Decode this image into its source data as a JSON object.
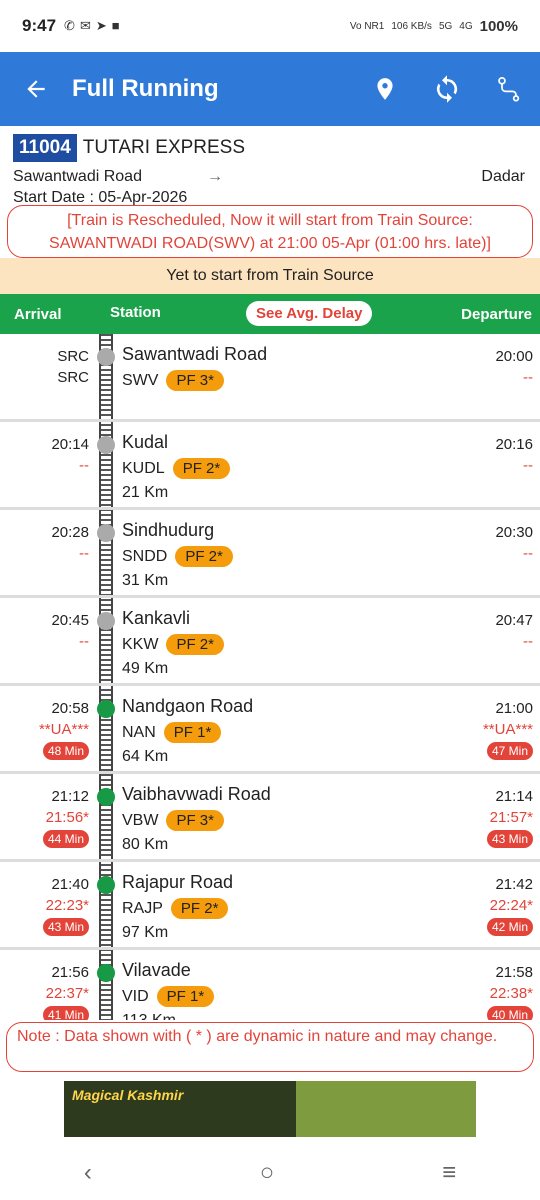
{
  "status": {
    "time": "9:47",
    "net1": "Vo NR1",
    "speed": "106 KB/s",
    "net2": "5G",
    "net3": "4G",
    "battery": "100%"
  },
  "appbar": {
    "title": "Full Running"
  },
  "train": {
    "number": "11004",
    "name": "TUTARI EXPRESS",
    "from": "Sawantwadi Road",
    "arrow": "→",
    "to": "Dadar",
    "start_date": "Start Date : 05-Apr-2026"
  },
  "notice": "[Train is Rescheduled, Now it will start from Train Source: SAWANTWADI ROAD(SWV) at 21:00 05-Apr (01:00 hrs. late)]",
  "yet_to_start": "Yet to start from Train Source",
  "table_header": {
    "arrival": "Arrival",
    "station": "Station",
    "avg_delay": "See Avg. Delay",
    "departure": "Departure"
  },
  "stations": [
    {
      "arr": "SRC",
      "arr2": "SRC",
      "arr_late": "",
      "dep": "20:00",
      "dep2": "--",
      "dep_late": "",
      "name": "Sawantwadi Road",
      "code": "SWV",
      "pf": "PF 3*",
      "km": "",
      "dot": "grey"
    },
    {
      "arr": "20:14",
      "arr2": "--",
      "arr_late": "",
      "dep": "20:16",
      "dep2": "--",
      "dep_late": "",
      "name": "Kudal",
      "code": "KUDL",
      "pf": "PF 2*",
      "km": "21 Km",
      "dot": "grey"
    },
    {
      "arr": "20:28",
      "arr2": "--",
      "arr_late": "",
      "dep": "20:30",
      "dep2": "--",
      "dep_late": "",
      "name": "Sindhudurg",
      "code": "SNDD",
      "pf": "PF 2*",
      "km": "31 Km",
      "dot": "grey"
    },
    {
      "arr": "20:45",
      "arr2": "--",
      "arr_late": "",
      "dep": "20:47",
      "dep2": "--",
      "dep_late": "",
      "name": "Kankavli",
      "code": "KKW",
      "pf": "PF 2*",
      "km": "49 Km",
      "dot": "grey"
    },
    {
      "arr": "20:58",
      "arr2": "**UA***",
      "arr_late": "48 Min",
      "dep": "21:00",
      "dep2": "**UA***",
      "dep_late": "47 Min",
      "name": "Nandgaon Road",
      "code": "NAN",
      "pf": "PF 1*",
      "km": "64 Km",
      "dot": "green"
    },
    {
      "arr": "21:12",
      "arr2": "21:56*",
      "arr_late": "44 Min",
      "dep": "21:14",
      "dep2": "21:57*",
      "dep_late": "43 Min",
      "name": "Vaibhavwadi Road",
      "code": "VBW",
      "pf": "PF 3*",
      "km": "80 Km",
      "dot": "green"
    },
    {
      "arr": "21:40",
      "arr2": "22:23*",
      "arr_late": "43 Min",
      "dep": "21:42",
      "dep2": "22:24*",
      "dep_late": "42 Min",
      "name": "Rajapur Road",
      "code": "RAJP",
      "pf": "PF 2*",
      "km": "97 Km",
      "dot": "green"
    },
    {
      "arr": "21:56",
      "arr2": "22:37*",
      "arr_late": "41 Min",
      "dep": "21:58",
      "dep2": "22:38*",
      "dep_late": "40 Min",
      "name": "Vilavade",
      "code": "VID",
      "pf": "PF 1*",
      "km": "113 Km",
      "dot": "green"
    }
  ],
  "note": "Note : Data shown with ( * ) are dynamic in nature and may change.",
  "ad": {
    "text": "Magical Kashmir"
  },
  "colors": {
    "appbar": "#2f7ad8",
    "header": "#1aa34a",
    "late": "#e2443a",
    "pf": "#f49c0c"
  }
}
